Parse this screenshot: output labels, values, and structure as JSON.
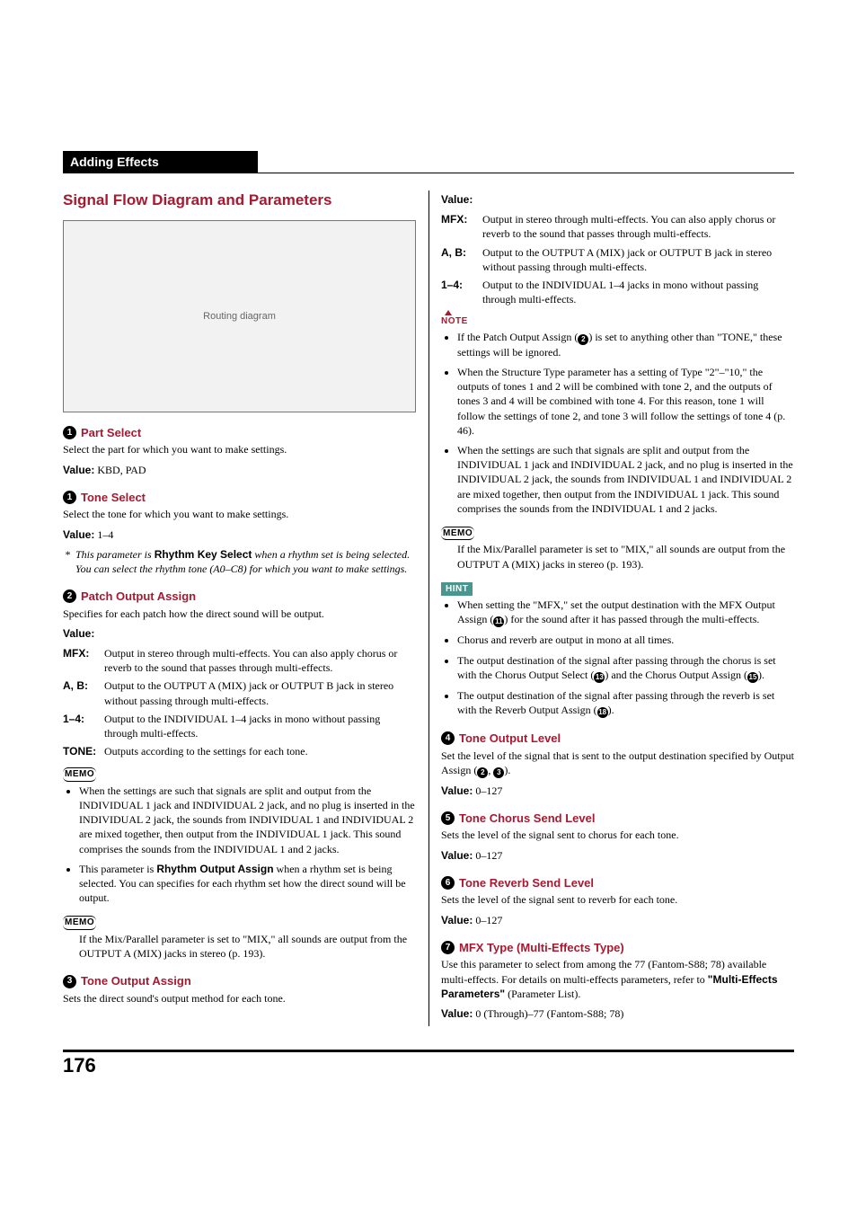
{
  "header": {
    "title": "Adding Effects"
  },
  "section_title": "Signal Flow Diagram and Parameters",
  "figure_alt": "Routing diagram",
  "badge": {
    "n1": "1",
    "n2": "2",
    "n3": "3",
    "n4": "4",
    "n5": "5",
    "n6": "6",
    "n7": "7",
    "n11": "11",
    "n13": "13",
    "n15": "15",
    "n18": "18"
  },
  "labels": {
    "value": "Value:",
    "note": "NOTE",
    "memo": "MEMO",
    "hint": "HINT"
  },
  "part_select": {
    "title": "Part Select",
    "desc": "Select the part for which you want to make settings.",
    "value": "KBD, PAD"
  },
  "tone_select": {
    "title": "Tone Select",
    "desc": "Select the tone for which you want to make settings.",
    "value": "1–4",
    "note_pre": "This parameter is ",
    "note_key": "Rhythm Key Select",
    "note_post": " when a rhythm set is being selected. You can select the rhythm tone (A0–C8) for which you want to make settings."
  },
  "patch_output": {
    "title": "Patch Output Assign",
    "desc": "Specifies for each patch how the direct sound will be output.",
    "mfx": "Output in stereo through multi-effects. You can also apply chorus or reverb to the sound that passes through multi-effects.",
    "ab": "Output to the OUTPUT A (MIX) jack or OUTPUT B jack in stereo without passing through multi-effects.",
    "one_four": "Output to the INDIVIDUAL 1–4 jacks in mono without passing through multi-effects.",
    "tone": "Outputs according to the settings for each tone.",
    "dt_mfx": "MFX:",
    "dt_ab": "A, B:",
    "dt_14": "1–4:",
    "dt_tone": "TONE:",
    "memo1_bullet": "When the settings are such that signals are split and output from the INDIVIDUAL 1 jack and INDIVIDUAL 2 jack, and no plug is inserted in the INDIVIDUAL 2 jack, the sounds from INDIVIDUAL 1 and INDIVIDUAL 2 are mixed together, then output from the INDIVIDUAL 1 jack. This sound comprises the sounds from the INDIVIDUAL 1 and 2 jacks.",
    "memo1_b2_pre": "This parameter is ",
    "memo1_b2_key": "Rhythm Output Assign",
    "memo1_b2_post": " when a rhythm set is being selected. You can specifies for each rhythm set how the direct sound will be output.",
    "memo2": "If the Mix/Parallel parameter is set to \"MIX,\" all sounds are output from the OUTPUT A (MIX) jacks in stereo (p. 193)."
  },
  "tone_output_assign": {
    "title": "Tone Output Assign",
    "desc": "Sets the direct sound's output method for each tone."
  },
  "right_value_list": {
    "mfx": "Output in stereo through multi-effects. You can also apply chorus or reverb to the sound that passes through multi-effects.",
    "ab": "Output to the OUTPUT A (MIX) jack or OUTPUT B jack in stereo without passing through multi-effects.",
    "one_four": "Output to the INDIVIDUAL 1–4 jacks in mono without passing through multi-effects.",
    "dt_mfx": "MFX:",
    "dt_ab": "A, B:",
    "dt_14": "1–4:"
  },
  "right_note": {
    "b1_pre": "If the Patch Output Assign (",
    "b1_post": ") is set to anything other than \"TONE,\" these settings will be ignored.",
    "b2": "When the Structure Type parameter has a setting of Type \"2\"–\"10,\" the outputs of tones 1 and 2 will be combined with tone 2, and the outputs of tones 3 and 4 will be combined with tone 4. For this reason, tone 1 will follow the settings of tone 2, and tone 3 will follow the settings of tone 4 (p. 46).",
    "b3": "When the settings are such that signals are split and output from the INDIVIDUAL 1 jack and INDIVIDUAL 2 jack, and no plug is inserted in the INDIVIDUAL 2 jack, the sounds from INDIVIDUAL 1 and INDIVIDUAL 2 are mixed together, then output from the INDIVIDUAL 1 jack. This sound comprises the sounds from the INDIVIDUAL 1 and 2 jacks."
  },
  "right_memo": "If the Mix/Parallel parameter is set to \"MIX,\" all sounds are output from the OUTPUT A (MIX) jacks in stereo (p. 193).",
  "right_hint": {
    "b1_pre": "When setting the \"MFX,\" set the output destination with the MFX Output Assign (",
    "b1_post": ") for the sound after it has passed through the multi-effects.",
    "b2": "Chorus and reverb are output in mono at all times.",
    "b3_pre": "The output destination of the signal after passing through the chorus is set with the Chorus Output Select (",
    "b3_mid": ") and the Chorus Output Assign (",
    "b3_post": ").",
    "b4_pre": "The output destination of the signal after passing through the reverb is set with the Reverb Output Assign (",
    "b4_post": ")."
  },
  "tone_output_level": {
    "title": "Tone Output Level",
    "desc_pre": "Set the level of the signal that is sent to the output destination specified by Output Assign (",
    "desc_mid": ", ",
    "desc_post": ").",
    "value": "0–127"
  },
  "tone_chorus": {
    "title": "Tone Chorus Send Level",
    "desc": "Sets the level of the signal sent to chorus for each tone.",
    "value": "0–127"
  },
  "tone_reverb": {
    "title": "Tone Reverb Send Level",
    "desc": "Sets the level of the signal sent to reverb for each tone.",
    "value": "0–127"
  },
  "mfx_type": {
    "title": "MFX Type (Multi-Effects Type)",
    "desc_pre": "Use this parameter to select from among the 77 (Fantom-S88; 78) available multi-effects. For details on multi-effects parameters, refer to ",
    "xref": "\"Multi-Effects Parameters\"",
    "desc_post": " (Parameter List).",
    "value": "0 (Through)–77 (Fantom-S88; 78)"
  },
  "page_number": "176"
}
